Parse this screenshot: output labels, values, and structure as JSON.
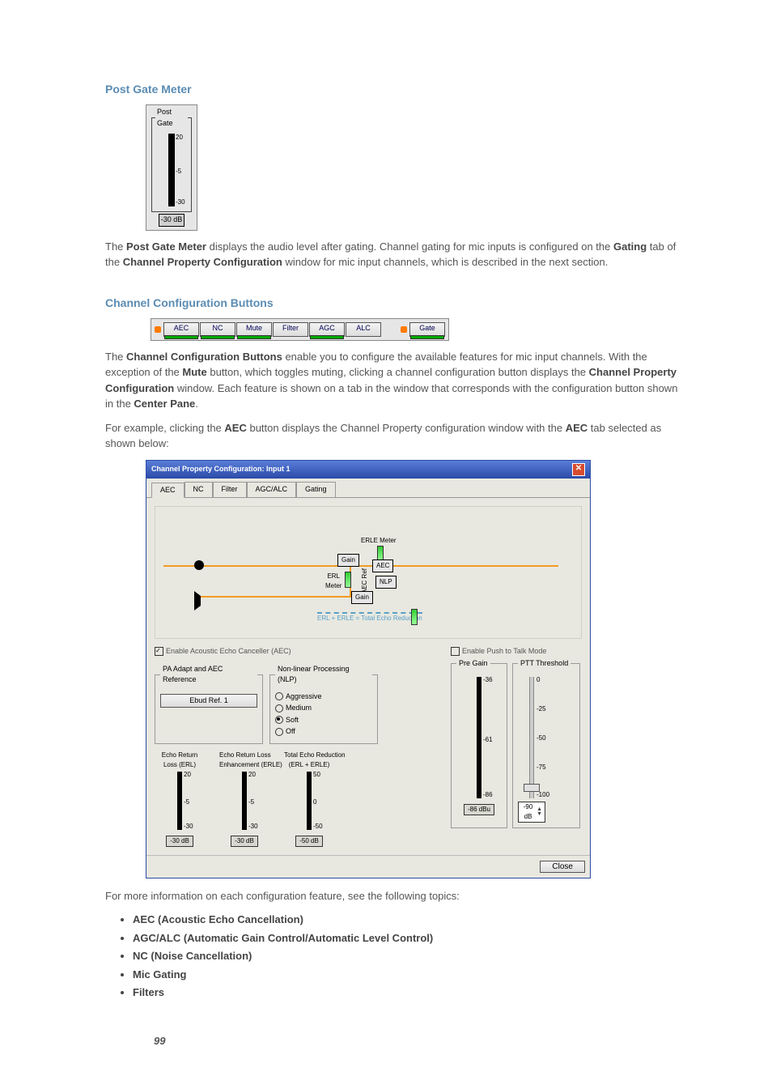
{
  "sections": {
    "post_gate_title": "Post Gate Meter",
    "channel_cfg_title": "Channel Configuration Buttons"
  },
  "pg_meter": {
    "legend": "Post Gate",
    "ticks": [
      "20",
      "-5",
      "-30"
    ],
    "value": "-30 dB"
  },
  "paragraphs": {
    "post_gate_pre": "The ",
    "post_gate_b1": "Post Gate Meter",
    "post_gate_mid1": " displays  the audio level after gating. Channel gating for mic inputs is configured on the ",
    "post_gate_b2": "Gating",
    "post_gate_mid2": " tab of the ",
    "post_gate_b3": "Channel Property Configuration",
    "post_gate_end": " window for mic input channels, which is described in the next section.",
    "chcfg_pre": "The ",
    "chcfg_b1": "Channel Configuration Buttons",
    "chcfg_mid1": " enable you to configure the available features for mic input channels. With the exception of the ",
    "chcfg_b2": "Mute",
    "chcfg_mid2": " button, which toggles muting, clicking a channel configuration button displays the ",
    "chcfg_b3": "Channel Property Configuration",
    "chcfg_mid3": " window. Each feature is shown on a tab in the window that corresponds with the configuration button shown in the ",
    "chcfg_b4": "Center Pane",
    "chcfg_end": ".",
    "example_pre": "For example, clicking the ",
    "example_b1": "AEC",
    "example_mid": " button displays the Channel Property configuration window with the ",
    "example_b2": "AEC",
    "example_end": " tab selected as shown below:",
    "moreinfo": "For more information on each configuration feature, see the following topics:"
  },
  "btn_row": [
    "AEC",
    "NC",
    "Mute",
    "Filter",
    "AGC",
    "ALC",
    "Gate"
  ],
  "window": {
    "title": "Channel Property Configuration: Input 1",
    "close_label": "Close",
    "tabs": [
      "AEC",
      "NC",
      "Filter",
      "AGC/ALC",
      "Gating"
    ],
    "diagram": {
      "erle_meter": "ERLE Meter",
      "gain1": "Gain",
      "aec": "AEC",
      "erl_meter": "ERL\nMeter",
      "aec_ref": "AEC Ref",
      "nlp": "NLP",
      "gain2": "Gain",
      "total": "ERL + ERLE = Total Echo Reduction"
    },
    "enable_aec": "Enable Acoustic Echo Canceller (AEC)",
    "pa_group": {
      "legend": "PA Adapt and AEC Reference",
      "button": "Ebud Ref. 1"
    },
    "nlp_group": {
      "legend": "Non-linear Processing (NLP)",
      "options": [
        "Aggressive",
        "Medium",
        "Soft",
        "Off"
      ],
      "selected": "Soft"
    },
    "push_to_talk": "Enable Push to Talk Mode",
    "pre_gain": {
      "legend": "Pre Gain",
      "top": "-36",
      "mid": "-61",
      "bot": "-86",
      "value": "-86 dBu"
    },
    "ptt_threshold": {
      "legend": "PTT Threshold",
      "ticks": [
        "0",
        "-25",
        "-50",
        "-75",
        "-100"
      ],
      "value": "-90 dB"
    },
    "meters": [
      {
        "title": "Echo Return\nLoss (ERL)",
        "ticks": [
          "20",
          "-5",
          "-30"
        ],
        "value": "-30 dB"
      },
      {
        "title": "Echo Return Loss\nEnhancement (ERLE)",
        "ticks": [
          "20",
          "-5",
          "-30"
        ],
        "value": "-30 dB"
      },
      {
        "title": "Total Echo Reduction\n(ERL + ERLE)",
        "ticks": [
          "50",
          "0",
          "-50"
        ],
        "value": "-50 dB"
      }
    ]
  },
  "topics": [
    "AEC (Acoustic Echo Cancellation)",
    "AGC/ALC (Automatic Gain Control/Automatic Level Control)",
    "NC (Noise Cancellation)",
    "Mic Gating",
    "Filters"
  ],
  "page_number": "99"
}
